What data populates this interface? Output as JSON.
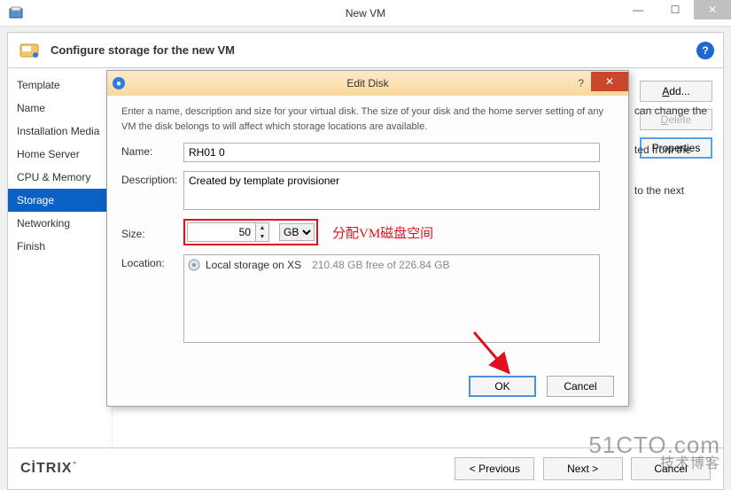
{
  "window": {
    "title": "New VM",
    "min_glyph": "—",
    "max_glyph": "☐",
    "close_glyph": "✕"
  },
  "header": {
    "title": "Configure storage for the new VM",
    "help_glyph": "?"
  },
  "sidebar": {
    "items": [
      {
        "label": "Template"
      },
      {
        "label": "Name"
      },
      {
        "label": "Installation Media"
      },
      {
        "label": "Home Server"
      },
      {
        "label": "CPU & Memory"
      },
      {
        "label": "Storage"
      },
      {
        "label": "Networking"
      },
      {
        "label": "Finish"
      }
    ],
    "active_index": 5
  },
  "main": {
    "peek_text": [
      "can change the",
      "ted from the",
      "to the next"
    ],
    "buttons": {
      "add": "Add...",
      "delete": "Delete",
      "properties": "Properties"
    }
  },
  "modal": {
    "title": "Edit Disk",
    "instructions": "Enter a name, description and size for your virtual disk. The size of your disk and the home server setting of any VM the disk belongs to will affect which storage locations are available.",
    "labels": {
      "name": "Name:",
      "description": "Description:",
      "size": "Size:",
      "location": "Location:"
    },
    "name_value": "RH01 0",
    "description_value": "Created by template provisioner",
    "size_value": "50",
    "size_unit": "GB",
    "annotation": "分配VM磁盘空间",
    "location": {
      "name": "Local storage on XS",
      "free": "210.48 GB free of 226.84 GB"
    },
    "ok": "OK",
    "cancel": "Cancel",
    "help_glyph": "?",
    "close_glyph": "✕"
  },
  "footer": {
    "brand": "CİTRIX",
    "previous": "< Previous",
    "next": "Next >",
    "cancel": "Cancel"
  },
  "watermark": {
    "line1": "51CTO.com",
    "line2": "技术博客"
  }
}
